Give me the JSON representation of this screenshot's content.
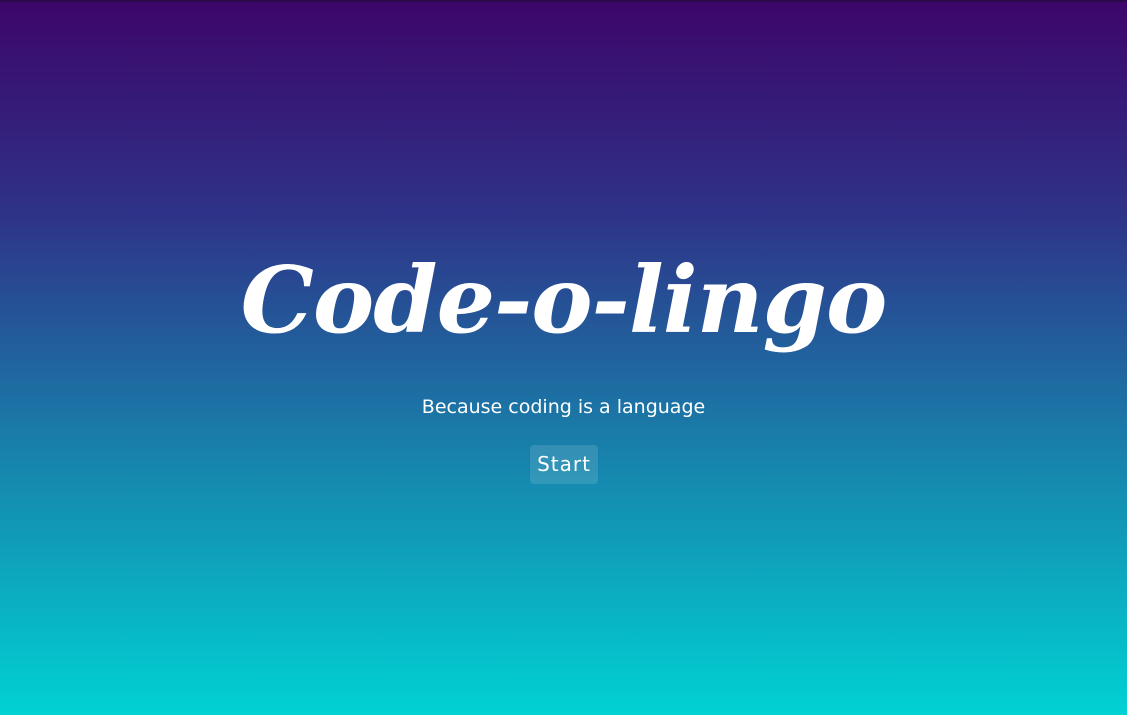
{
  "hero": {
    "title": "Code-o-lingo",
    "subtitle": "Because coding is a language",
    "start_label": "Start"
  },
  "colors": {
    "gradient_top": "#3d0569",
    "gradient_mid": "#1a7aa8",
    "gradient_bottom": "#00d2d3",
    "text": "#ffffff"
  }
}
